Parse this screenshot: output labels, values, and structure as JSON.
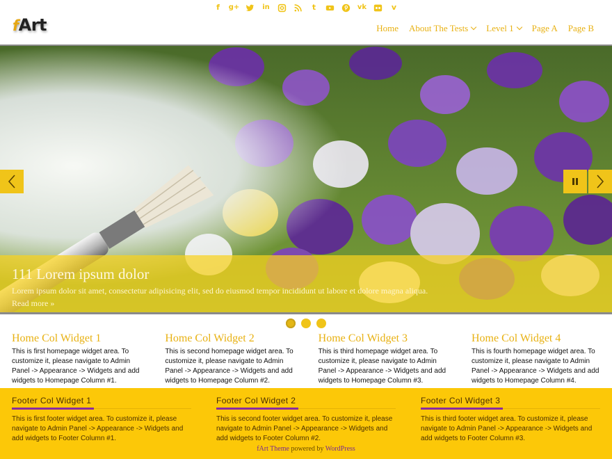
{
  "header": {
    "social_icons": [
      "facebook-icon",
      "google-plus-icon",
      "twitter-icon",
      "linkedin-icon",
      "instagram-icon",
      "rss-icon",
      "tumblr-icon",
      "youtube-icon",
      "pinterest-icon",
      "vk-icon",
      "flickr-icon",
      "vimeo-icon"
    ],
    "logo_f": "f",
    "logo_rest": "Art",
    "nav": {
      "home": "Home",
      "about": "About The Tests",
      "level1": "Level 1",
      "page_a": "Page A",
      "page_b": "Page B"
    }
  },
  "slider": {
    "title": "111 Lorem ipsum dolor",
    "text": "Lorem ipsum dolor sit amet, consectetur adipisicing elit, sed do eiusmod tempor incididunt ut labore et dolore magna aliqua.",
    "read_more": "Read more",
    "read_more_arrow": "»",
    "slide_count": 3,
    "active_slide": 1
  },
  "home_widgets": [
    {
      "title": "Home Col Widget 1",
      "text": "This is first homepage widget area. To customize it, please navigate to Admin Panel -> Appearance -> Widgets and add widgets to Homepage Column #1."
    },
    {
      "title": "Home Col Widget 2",
      "text": "This is second homepage widget area. To customize it, please navigate to Admin Panel -> Appearance -> Widgets and add widgets to Homepage Column #2."
    },
    {
      "title": "Home Col Widget 3",
      "text": "This is third homepage widget area. To customize it, please navigate to Admin Panel -> Appearance -> Widgets and add widgets to Homepage Column #3."
    },
    {
      "title": "Home Col Widget 4",
      "text": "This is fourth homepage widget area. To customize it, please navigate to Admin Panel -> Appearance -> Widgets and add widgets to Homepage Column #4."
    }
  ],
  "footer_widgets": [
    {
      "title": "Footer Col Widget 1",
      "text": "This is first footer widget area. To customize it, please navigate to Admin Panel -> Appearance -> Widgets and add widgets to Footer Column #1."
    },
    {
      "title": "Footer Col Widget 2",
      "text": "This is second footer widget area. To customize it, please navigate to Admin Panel -> Appearance -> Widgets and add widgets to Footer Column #2."
    },
    {
      "title": "Footer Col Widget 3",
      "text": "This is third footer widget area. To customize it, please navigate to Admin Panel -> Appearance -> Widgets and add widgets to Footer Column #3."
    }
  ],
  "credits": {
    "theme_link": "fArt Theme",
    "powered_by": " powered by ",
    "wp_link": "WordPress"
  },
  "colors": {
    "accent": "#f0c419",
    "footer_bg": "#fcc808",
    "underline": "#8a2ca0"
  }
}
